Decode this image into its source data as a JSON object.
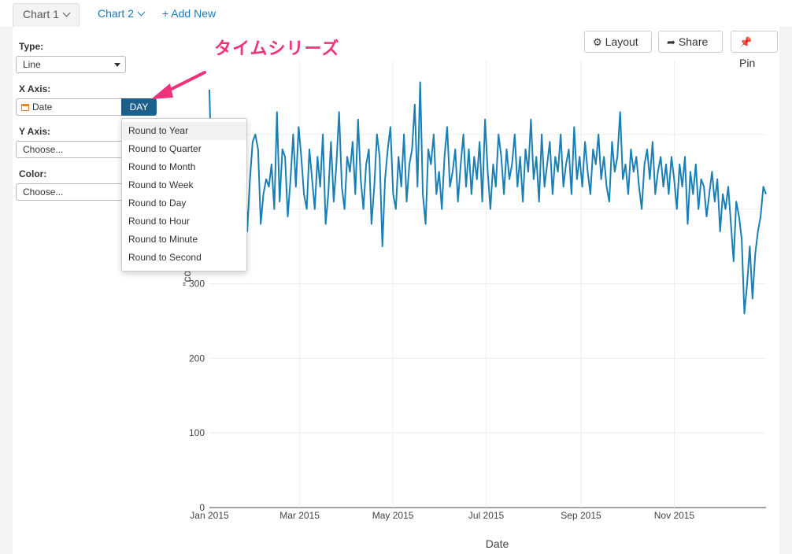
{
  "tabs": [
    {
      "label": "Chart 1"
    },
    {
      "label": "Chart 2"
    },
    {
      "label": "+ Add New"
    }
  ],
  "controls": {
    "type_label": "Type:",
    "type_value": "Line",
    "xaxis_label": "X Axis:",
    "xaxis_value": "Date",
    "xaxis_round_button": "DAY",
    "yaxis_label": "Y Axis:",
    "yaxis_value": "Choose...",
    "color_label": "Color:",
    "color_value": "Choose..."
  },
  "round_menu": [
    "Round to Year",
    "Round to Quarter",
    "Round to Month",
    "Round to Week",
    "Round to Day",
    "Round to Hour",
    "Round to Minute",
    "Round to Second"
  ],
  "annotation": "タイムシリーズ",
  "toolbar": {
    "layout_label": "Layout",
    "share_label": "Share",
    "pin_label": "Pin"
  },
  "colors": {
    "line": "#1a7fb5",
    "accent_pink": "#f0317b",
    "day_button": "#1b5f8c"
  },
  "chart_data": {
    "type": "line",
    "xlabel": "Date",
    "ylabel": "\"count(",
    "x_ticks": [
      "Jan 2015",
      "Mar 2015",
      "May 2015",
      "Jul 2015",
      "Sep 2015",
      "Nov 2015"
    ],
    "y_ticks": [
      "0",
      "100",
      "200",
      "300"
    ],
    "ylim": [
      0,
      600
    ],
    "grid": true,
    "x_range": [
      "2015-01-01",
      "2015-12-31"
    ],
    "series": [
      {
        "values": [
          560,
          420,
          510,
          440,
          470,
          430,
          400,
          470,
          450,
          490,
          380,
          520,
          460,
          480,
          370,
          440,
          490,
          500,
          480,
          380,
          420,
          440,
          430,
          460,
          400,
          530,
          410,
          480,
          470,
          390,
          440,
          500,
          430,
          510,
          470,
          420,
          400,
          480,
          440,
          400,
          470,
          430,
          500,
          380,
          420,
          490,
          410,
          460,
          530,
          430,
          400,
          470,
          450,
          490,
          420,
          520,
          440,
          400,
          460,
          480,
          380,
          430,
          500,
          470,
          350,
          440,
          480,
          510,
          420,
          400,
          470,
          430,
          500,
          410,
          460,
          480,
          540,
          430,
          570,
          420,
          380,
          480,
          460,
          500,
          420,
          450,
          400,
          470,
          510,
          430,
          450,
          480,
          410,
          460,
          500,
          430,
          480,
          420,
          470,
          440,
          490,
          410,
          520,
          450,
          400,
          460,
          430,
          500,
          470,
          420,
          480,
          440,
          460,
          500,
          430,
          470,
          410,
          480,
          450,
          520,
          440,
          470,
          410,
          500,
          430,
          460,
          490,
          420,
          470,
          450,
          500,
          430,
          460,
          480,
          420,
          510,
          440,
          470,
          430,
          490,
          450,
          420,
          480,
          460,
          500,
          440,
          470,
          430,
          410,
          490,
          450,
          470,
          530,
          440,
          460,
          420,
          480,
          450,
          470,
          430,
          400,
          460,
          480,
          440,
          490,
          420,
          450,
          470,
          430,
          460,
          420,
          470,
          440,
          400,
          460,
          430,
          470,
          380,
          450,
          420,
          460,
          400,
          440,
          430,
          390,
          420,
          450,
          410,
          440,
          370,
          420,
          400,
          430,
          380,
          330,
          410,
          390,
          360,
          260,
          300,
          350,
          280,
          340,
          370,
          390,
          430,
          420
        ]
      }
    ]
  }
}
